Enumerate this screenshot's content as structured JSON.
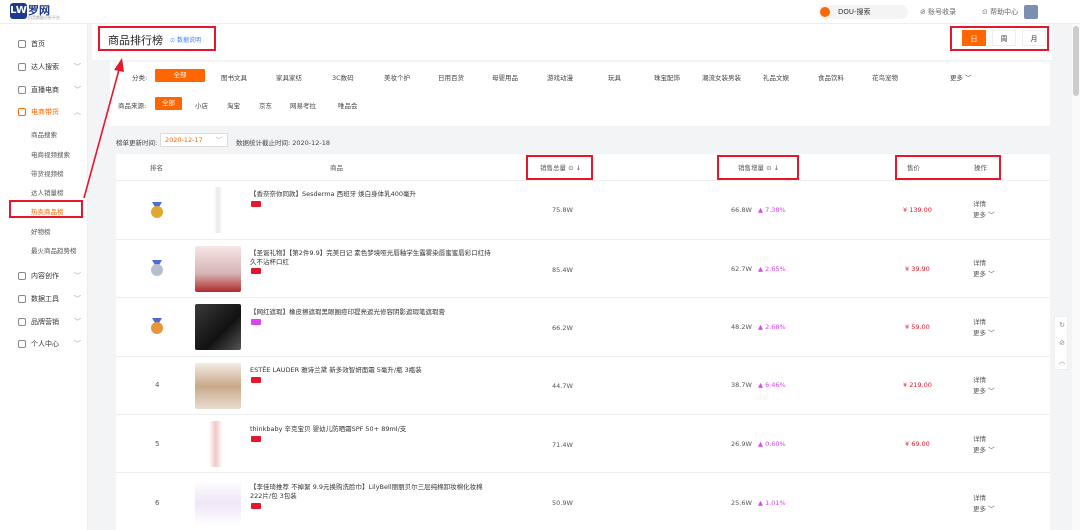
{
  "logo": {
    "text": "罗网",
    "mark": "LW",
    "sub": "抖音数据分析平台"
  },
  "topbar": {
    "dou_search": "DOU-搜索",
    "account": "账号收录",
    "help": "帮助中心"
  },
  "sidebar": {
    "items": [
      {
        "label": "首页"
      },
      {
        "label": "达人搜索"
      },
      {
        "label": "直播电商"
      },
      {
        "label": "电商带货"
      },
      {
        "label": "内容创作"
      },
      {
        "label": "数据工具"
      },
      {
        "label": "品牌营销"
      },
      {
        "label": "个人中心"
      }
    ],
    "sub_items": [
      "商品搜索",
      "电商视频搜索",
      "带货视频榜",
      "达人销量榜",
      "热卖商品榜",
      "好物榜",
      "最火商品趋势榜"
    ],
    "active_sub": "热卖商品榜"
  },
  "header": {
    "title": "商品排行榜",
    "explain": "数据说明",
    "periods": [
      "日",
      "周",
      "月"
    ],
    "active_period": "日"
  },
  "filters": {
    "category_label": "分类:",
    "categories": [
      "全部",
      "图书文具",
      "家具家纺",
      "3C数码",
      "美妆个护",
      "日用百货",
      "母婴用品",
      "游戏动漫",
      "玩具",
      "珠宝配饰",
      "潮流女装男装",
      "礼品文娱",
      "食品饮料",
      "花鸟宠物",
      "更多"
    ],
    "source_label": "商品来源:",
    "sources": [
      "全部",
      "小店",
      "淘宝",
      "京东",
      "网易考拉",
      "唯品会"
    ]
  },
  "date_row": {
    "label": "榜单更新时间:",
    "value": "2020-12-17",
    "stat_cut": "数据统计截止时间: 2020-12-18"
  },
  "table": {
    "headers": {
      "rank": "排名",
      "product": "商品",
      "total_sales": "销售总量",
      "sales_growth": "销售增量",
      "price": "售价",
      "op": "操作"
    },
    "rows": [
      {
        "rank": "1",
        "name": "【香奈奈你同款】Sesderma 西班牙 焕白身体乳400毫升",
        "total": "75.8W",
        "incr": "66.8W",
        "growth": "▲ 7.38%",
        "price": "¥ 139.00"
      },
      {
        "rank": "2",
        "name": "【圣诞礼物】【第2件9.9】完美日记 素色梦境哑光唇釉学生露雾染唇蜜蜜唇彩口红持久不沾杯口红",
        "total": "85.4W",
        "incr": "62.7W",
        "growth": "▲ 2.65%",
        "price": "¥ 39.90"
      },
      {
        "rank": "3",
        "name": "【网红遮瑕】橡皮擦遮瑕黑眼圈痘印提亮遮光修容阴影遮瑕笔遮瑕膏",
        "total": "66.2W",
        "incr": "48.2W",
        "growth": "▲ 2.68%",
        "price": "¥ 59.00"
      },
      {
        "rank": "4",
        "name": "ESTĒE LAUDER 雅诗兰黛 新多效智妍面霜 5毫升/瓶 3瓶装",
        "total": "44.7W",
        "incr": "38.7W",
        "growth": "▲ 6.46%",
        "price": "¥ 219.00"
      },
      {
        "rank": "5",
        "name": "thinkbaby 辛克宝贝 婴幼儿防晒霜SPF 50+ 89ml/支",
        "total": "71.4W",
        "incr": "26.9W",
        "growth": "▲ 0.60%",
        "price": "¥ 69.00"
      },
      {
        "rank": "6",
        "name": "【李佳琦推荐 不掉絮 9.9元换购洗脸巾】LilyBell丽丽贝尔三层纯棉卸妆棉化妆棉222片/包 3包装",
        "total": "50.9W",
        "incr": "25.6W",
        "growth": "▲ 1.01%",
        "price": ""
      }
    ],
    "op_detail": "详情",
    "op_more": "更多"
  },
  "colors": {
    "accent": "#ff6600",
    "highlight": "#e6162d",
    "growth": "#d946ef"
  }
}
